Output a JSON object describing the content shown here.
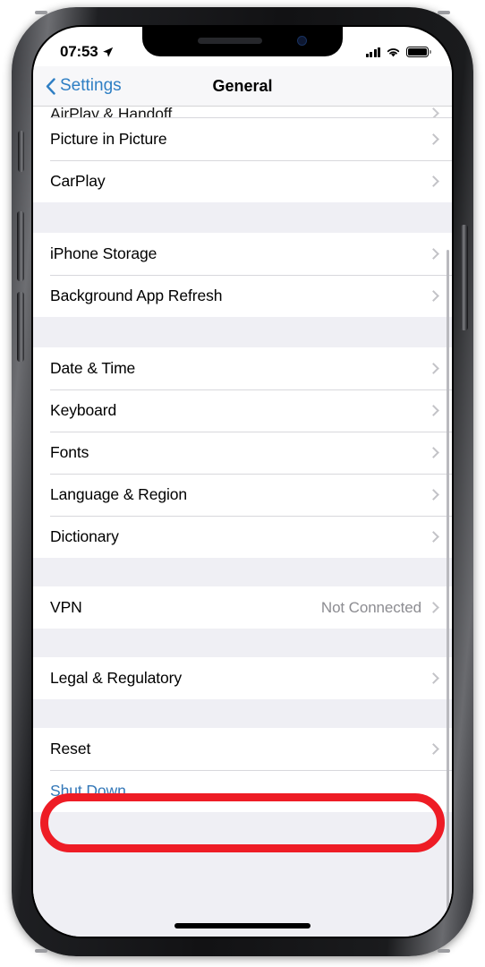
{
  "device": {
    "name": "iPhone",
    "notch": {
      "speaker": "speaker-grille",
      "camera": "front-camera"
    },
    "buttons": {
      "mute": "mute-switch",
      "volume_up": "volume-up-button",
      "volume_down": "volume-down-button",
      "power": "power-button"
    }
  },
  "status_bar": {
    "time": "07:53",
    "location_icon": "location-arrow-icon",
    "signal_icon": "cellular-signal-icon",
    "signal_bars": 4,
    "wifi_icon": "wifi-icon",
    "battery_icon": "battery-full-icon",
    "battery_level": 100
  },
  "nav_bar": {
    "back_icon": "chevron-left-icon",
    "back_label": "Settings",
    "title": "General"
  },
  "colors": {
    "accent_blue": "#3478b8",
    "highlight_red": "#ee1c25",
    "list_background": "#efeff4",
    "row_background": "#ffffff",
    "separator": "#d8d8dc",
    "value_text": "#8c8c91",
    "chevron": "#c3c3c7"
  },
  "annotation": {
    "type": "red-oval-highlight",
    "target": "Reset",
    "color": "#ee1c25"
  },
  "list": {
    "partial_row": {
      "label": "AirPlay & Handoff",
      "accessory": "chevron-right-icon"
    },
    "groups": [
      {
        "id": "media-group",
        "rows": [
          {
            "label": "Picture in Picture",
            "value": "",
            "accessory": "chevron-right-icon",
            "style": "default"
          },
          {
            "label": "CarPlay",
            "value": "",
            "accessory": "chevron-right-icon",
            "style": "default"
          }
        ]
      },
      {
        "id": "storage-group",
        "rows": [
          {
            "label": "iPhone Storage",
            "value": "",
            "accessory": "chevron-right-icon",
            "style": "default"
          },
          {
            "label": "Background App Refresh",
            "value": "",
            "accessory": "chevron-right-icon",
            "style": "default"
          }
        ]
      },
      {
        "id": "localization-group",
        "rows": [
          {
            "label": "Date & Time",
            "value": "",
            "accessory": "chevron-right-icon",
            "style": "default"
          },
          {
            "label": "Keyboard",
            "value": "",
            "accessory": "chevron-right-icon",
            "style": "default"
          },
          {
            "label": "Fonts",
            "value": "",
            "accessory": "chevron-right-icon",
            "style": "default"
          },
          {
            "label": "Language & Region",
            "value": "",
            "accessory": "chevron-right-icon",
            "style": "default"
          },
          {
            "label": "Dictionary",
            "value": "",
            "accessory": "chevron-right-icon",
            "style": "default"
          }
        ]
      },
      {
        "id": "vpn-group",
        "rows": [
          {
            "label": "VPN",
            "value": "Not Connected",
            "accessory": "chevron-right-icon",
            "style": "default"
          }
        ]
      },
      {
        "id": "legal-group",
        "rows": [
          {
            "label": "Legal & Regulatory",
            "value": "",
            "accessory": "chevron-right-icon",
            "style": "default"
          }
        ]
      },
      {
        "id": "reset-group",
        "rows": [
          {
            "label": "Reset",
            "value": "",
            "accessory": "chevron-right-icon",
            "style": "default"
          },
          {
            "label": "Shut Down",
            "value": "",
            "accessory": "",
            "style": "action"
          }
        ]
      }
    ]
  }
}
